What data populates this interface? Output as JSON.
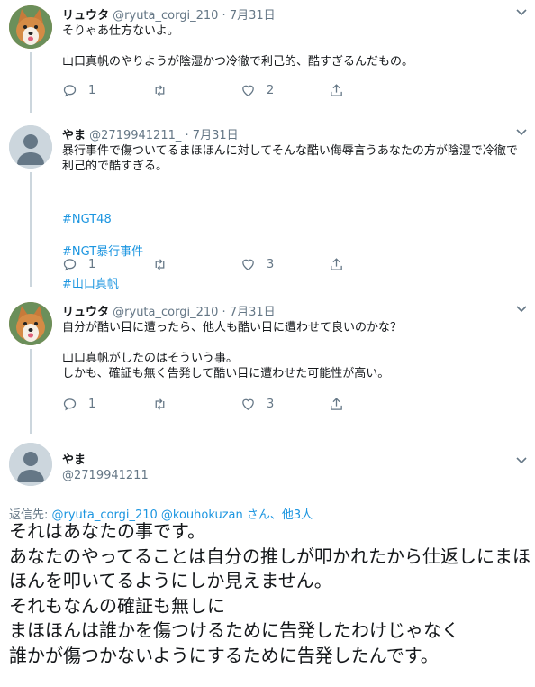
{
  "colors": {
    "link": "#1b95e0",
    "secondary": "#657786",
    "text": "#14171a",
    "divider": "#e6ecf0"
  },
  "tweets": [
    {
      "name": "リュウタ",
      "handle": "@ryuta_corgi_210",
      "dot": "·",
      "date": "7月31日",
      "avatar": "corgi-photo",
      "text": "そりゃあ仕方ないよ。\n\n山口真帆のやりようが陰湿かつ冷徹で利己的、酷すぎるんだもの。",
      "replies": "1",
      "likes": "2"
    },
    {
      "name": "やま",
      "handle": "@2719941211_",
      "dot": "·",
      "date": "7月31日",
      "avatar": "default-profile",
      "text": "暴行事件で傷ついてるまほほんに対してそんな酷い侮辱言うあなたの方が陰湿で冷徹で利己的で酷すぎる。",
      "hashtags": [
        "#NGT48",
        "#NGT暴行事件",
        "#山口真帆"
      ],
      "replies": "1",
      "likes": "3"
    },
    {
      "name": "リュウタ",
      "handle": "@ryuta_corgi_210",
      "dot": "·",
      "date": "7月31日",
      "avatar": "corgi-photo",
      "text": "自分が酷い目に遭ったら、他人も酷い目に遭わせて良いのかな？\n\n山口真帆がしたのはそういう事。\nしかも、確証も無く告発して酷い目に遭わせた可能性が高い。",
      "replies": "1",
      "likes": "3"
    }
  ],
  "main_tweet": {
    "name": "やま",
    "handle": "@2719941211_",
    "avatar": "default-profile",
    "reply_prefix": "返信先: ",
    "reply_users": "@ryuta_corgi_210 @kouhokuzan",
    "reply_suffix": " さん、他3人",
    "text": "それはあなたの事です。\nあなたのやってることは自分の推しが叩かれたから仕返しにまほほんを叩いてるようにしか見えません。\nそれもなんの確証も無しに\nまほほんは誰かを傷つけるために告発したわけじゃなく\n誰かが傷つかないようにするために告発したんです。"
  }
}
